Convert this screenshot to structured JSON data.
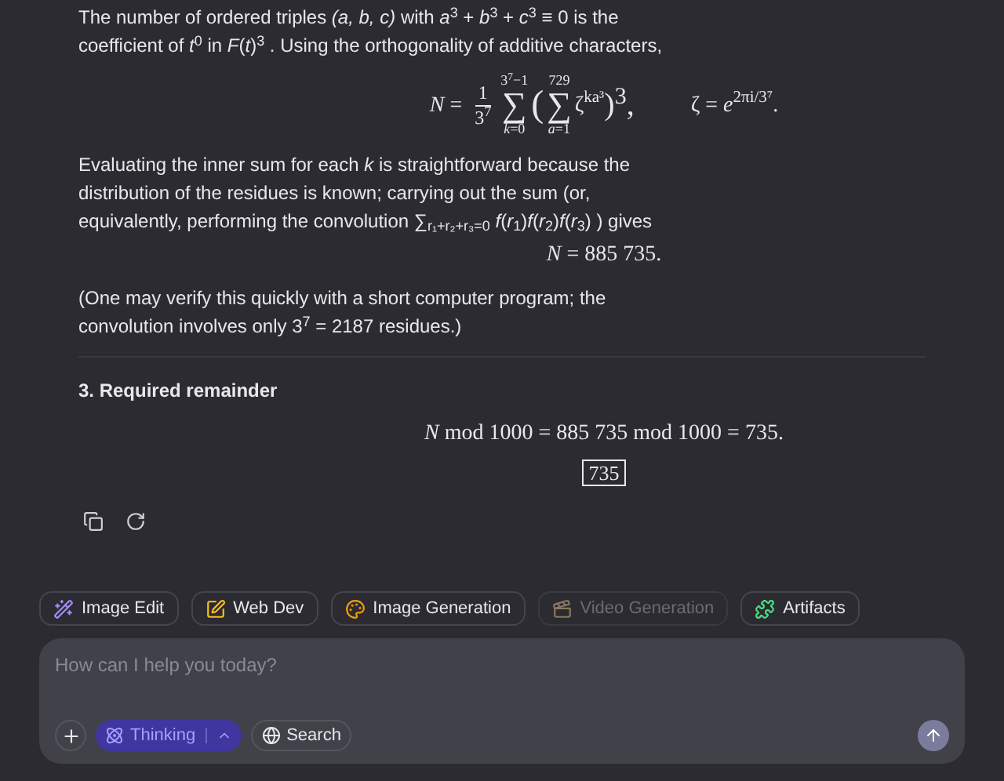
{
  "message": {
    "paragraph_1": "The number of ordered triples *(a, b, c)* with *a*$^{3}$ + *b*$^{3}$ + *c*$^{3}$ ≡ 0 is the coefficient of *t*$^{0}$ in *F*(*t*)$^{3}$ . Using the orthogonality of additive characters,",
    "equation_1": {
      "lhs": "*N* =",
      "numerator": "1",
      "denominator": "3$^{7}$",
      "sum_symbol": "∑",
      "inner_symbol": "∑",
      "sum_upper": "3$^{7}$−1",
      "sum_lower": "*k*=0",
      "open": "(",
      "inner_upper": "729",
      "inner_lower": "*a*=1",
      "term": "ζ$^{ka³}$",
      "close": ")$^{3}$,",
      "definition": "ζ = *e*$^{2πi/3⁷}$."
    },
    "paragraph_2": "Evaluating the inner sum for each *k* is straightforward because the distribution of the residues is known; carrying out the sum (or, equivalently, performing the convolution ∑$_{r₁+r₂+r₃=0}$ *f*(*r*$_{1}$)*f*(*r*$_{2}$)*f*(*r*$_{3}$) ) gives",
    "equation_2": "*N* = 885 735.",
    "paragraph_3": "(One may verify this quickly with a short computer program; the convolution involves only 3$^{7}$ = 2187 residues.)",
    "heading": "3. Required remainder",
    "equation_3": "*N* mod 1000 = 885 735 mod 1000 = 735.",
    "boxed_answer": "735"
  },
  "chips": [
    {
      "kind": "edit",
      "label": "Image Edit",
      "disabled": false
    },
    {
      "kind": "web",
      "label": "Web Dev",
      "disabled": false
    },
    {
      "kind": "palette",
      "label": "Image Generation",
      "disabled": false
    },
    {
      "kind": "video",
      "label": "Video Generation",
      "disabled": true
    },
    {
      "kind": "puzzle",
      "label": "Artifacts",
      "disabled": false
    }
  ],
  "composer": {
    "placeholder": "How can I help you today?",
    "thinking": {
      "label": "Thinking",
      "on": true
    },
    "search": {
      "label": "Search",
      "on": false
    }
  }
}
